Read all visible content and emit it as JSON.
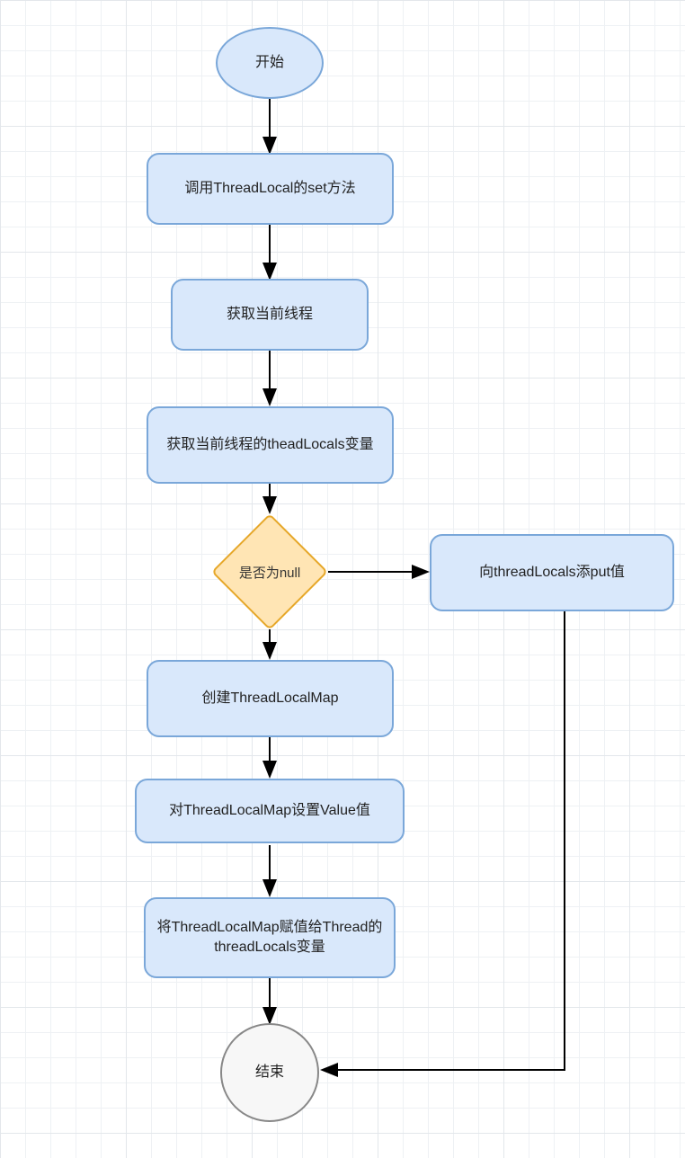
{
  "nodes": {
    "start": "开始",
    "step1": "调用ThreadLocal的set方法",
    "step2": "获取当前线程",
    "step3": "获取当前线程的theadLocals变量",
    "decision": "是否为null",
    "rightBranch": "向threadLocals添put值",
    "step4": "创建ThreadLocalMap",
    "step5": "对ThreadLocalMap设置Value值",
    "step6": "将ThreadLocalMap赋值给Thread的threadLocals变量",
    "end": "结束"
  }
}
